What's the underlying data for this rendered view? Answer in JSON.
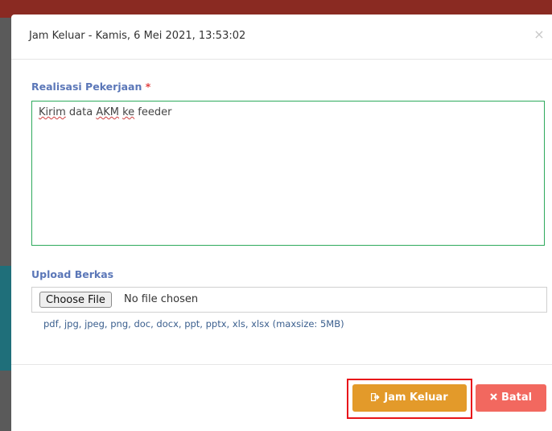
{
  "modal": {
    "title": "Jam Keluar - Kamis, 6 Mei 2021, 13:53:02",
    "close_icon": "×"
  },
  "form": {
    "realisasi_label": "Realisasi Pekerjaan",
    "required_mark": "*",
    "realisasi_value_words": [
      "Kirim",
      " data ",
      "AKM",
      " ",
      "ke",
      " feeder"
    ],
    "upload_label": "Upload Berkas",
    "file_button_label": "Choose File",
    "file_status": "No file chosen",
    "file_help": "pdf, jpg, jpeg, png, doc, docx, ppt, pptx, xls, xlsx (maxsize: 5MB)"
  },
  "footer": {
    "submit_label": "Jam Keluar",
    "submit_icon": "sign-out-icon",
    "cancel_label": "Batal",
    "cancel_icon": "times-icon"
  },
  "colors": {
    "submit": "#e39a2a",
    "cancel": "#f2685f",
    "label": "#5b77b8",
    "textarea_border": "#2eaa5c",
    "highlight": "#e8141a"
  }
}
